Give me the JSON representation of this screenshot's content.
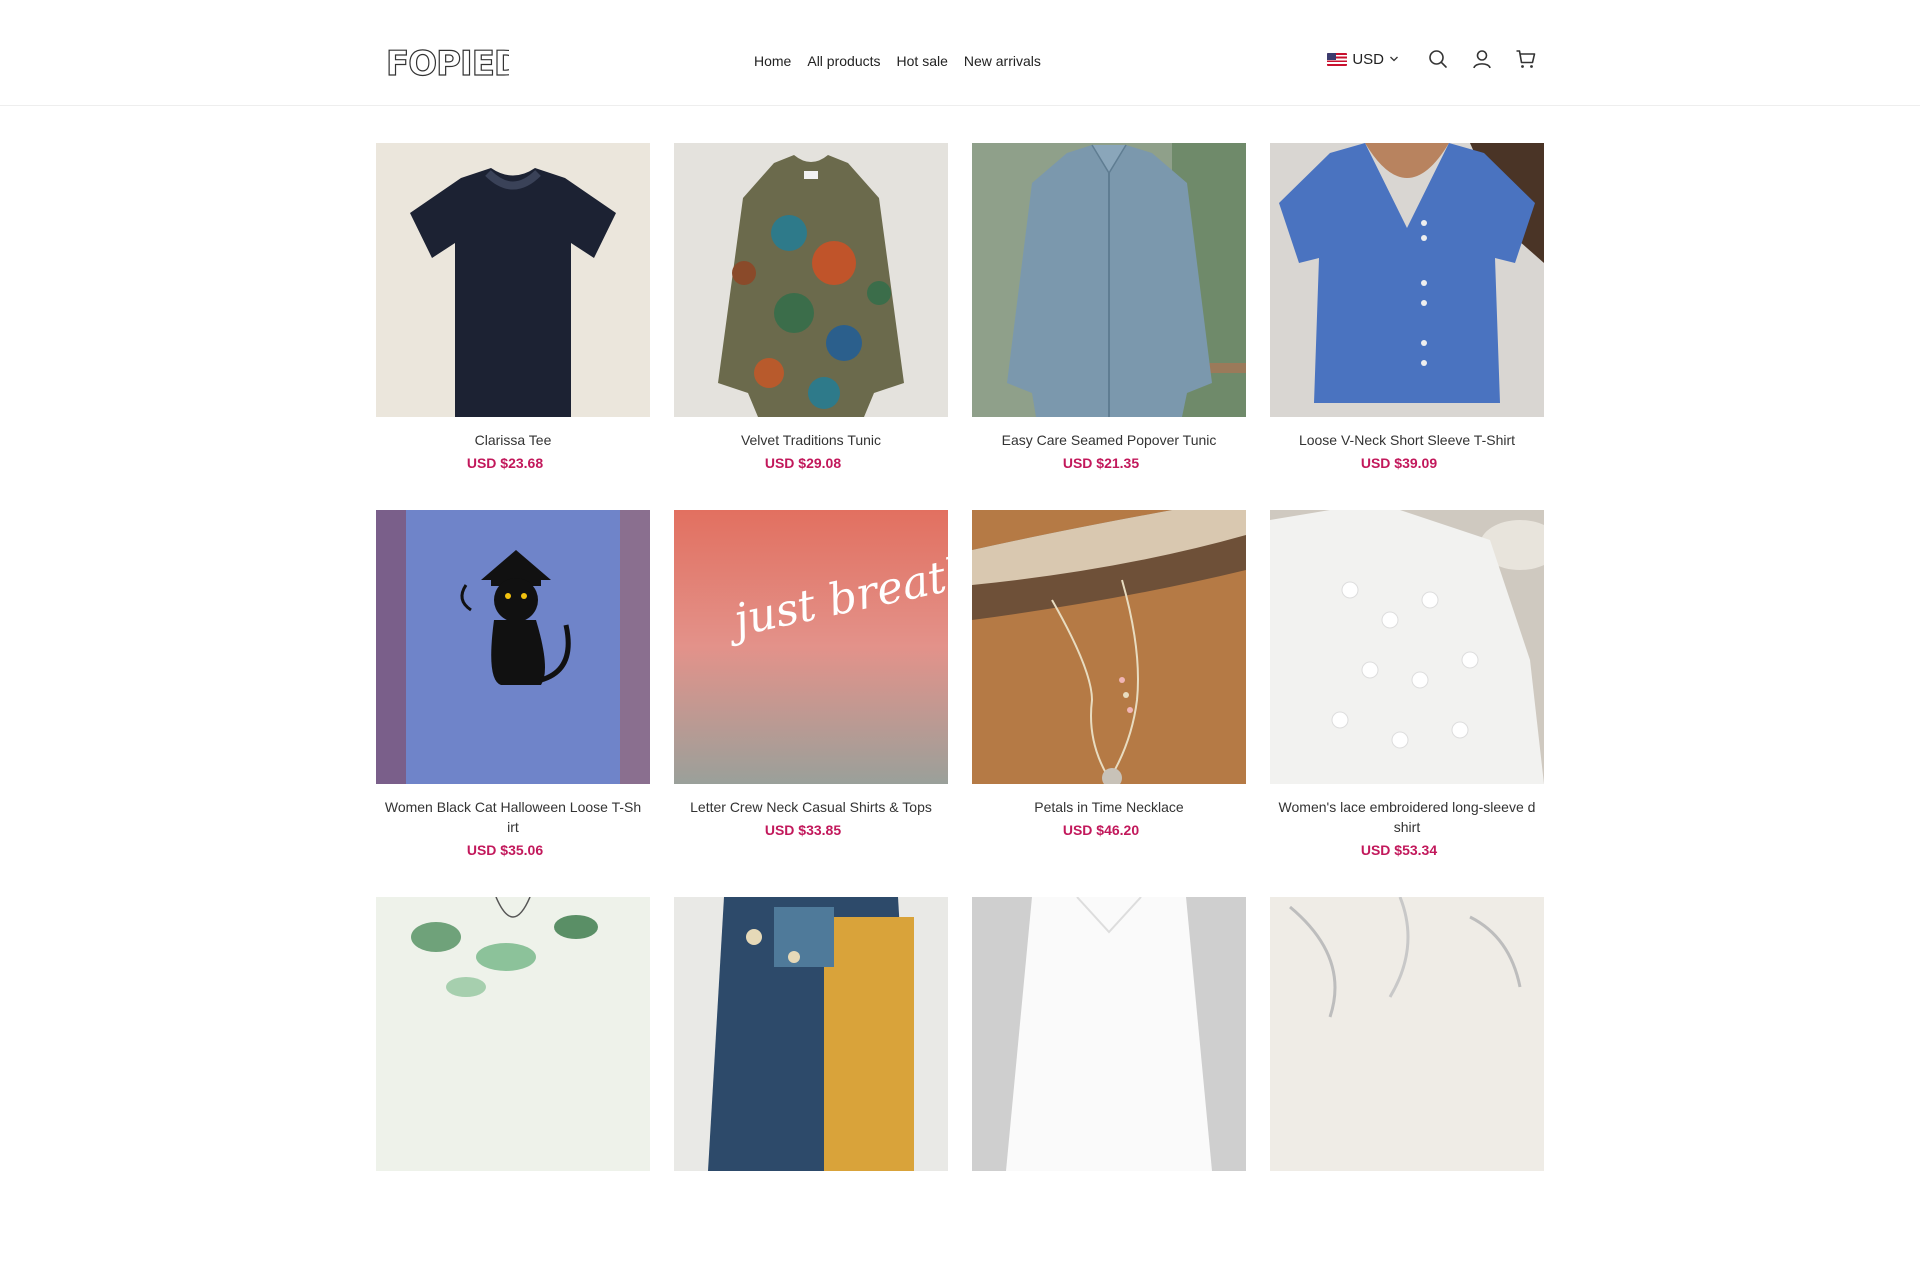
{
  "brand": {
    "logo_text": "FOPIED"
  },
  "nav": {
    "items": [
      {
        "label": "Home"
      },
      {
        "label": "All products"
      },
      {
        "label": "Hot sale"
      },
      {
        "label": "New arrivals"
      }
    ]
  },
  "header": {
    "currency": "USD",
    "icons": [
      "search-icon",
      "account-icon",
      "cart-icon"
    ]
  },
  "colors": {
    "price": "#c2185b",
    "text": "#333333",
    "border": "#eeeeee"
  },
  "products": [
    {
      "title": "Clarissa Tee",
      "price": "USD $23.68"
    },
    {
      "title": "Velvet Traditions Tunic",
      "price": "USD $29.08"
    },
    {
      "title": "Easy Care Seamed Popover Tunic",
      "price": "USD $21.35"
    },
    {
      "title": "Loose V-Neck Short Sleeve T-Shirt",
      "price": "USD $39.09"
    },
    {
      "title": "Women Black Cat Halloween Loose T-Sh irt",
      "price": "USD $35.06"
    },
    {
      "title": "Letter Crew Neck Casual Shirts & Tops",
      "price": "USD $33.85"
    },
    {
      "title": "Petals in Time Necklace",
      "price": "USD $46.20"
    },
    {
      "title": "Women's lace embroidered long-sleeve d shirt",
      "price": "USD $53.34"
    }
  ],
  "product_images": [
    {
      "alt": "black-tee-image"
    },
    {
      "alt": "paisley-tunic-image"
    },
    {
      "alt": "blue-shirt-image"
    },
    {
      "alt": "blue-vneck-image"
    },
    {
      "alt": "black-cat-tee-image"
    },
    {
      "alt": "just-breathe-tee-image"
    },
    {
      "alt": "necklace-image"
    },
    {
      "alt": "white-lace-shirt-image"
    },
    {
      "alt": "green-floral-image"
    },
    {
      "alt": "patchwork-dress-image"
    },
    {
      "alt": "white-shirt-image"
    },
    {
      "alt": "silver-necklace-image"
    }
  ],
  "image_text": {
    "tee_print": "just breathe"
  }
}
